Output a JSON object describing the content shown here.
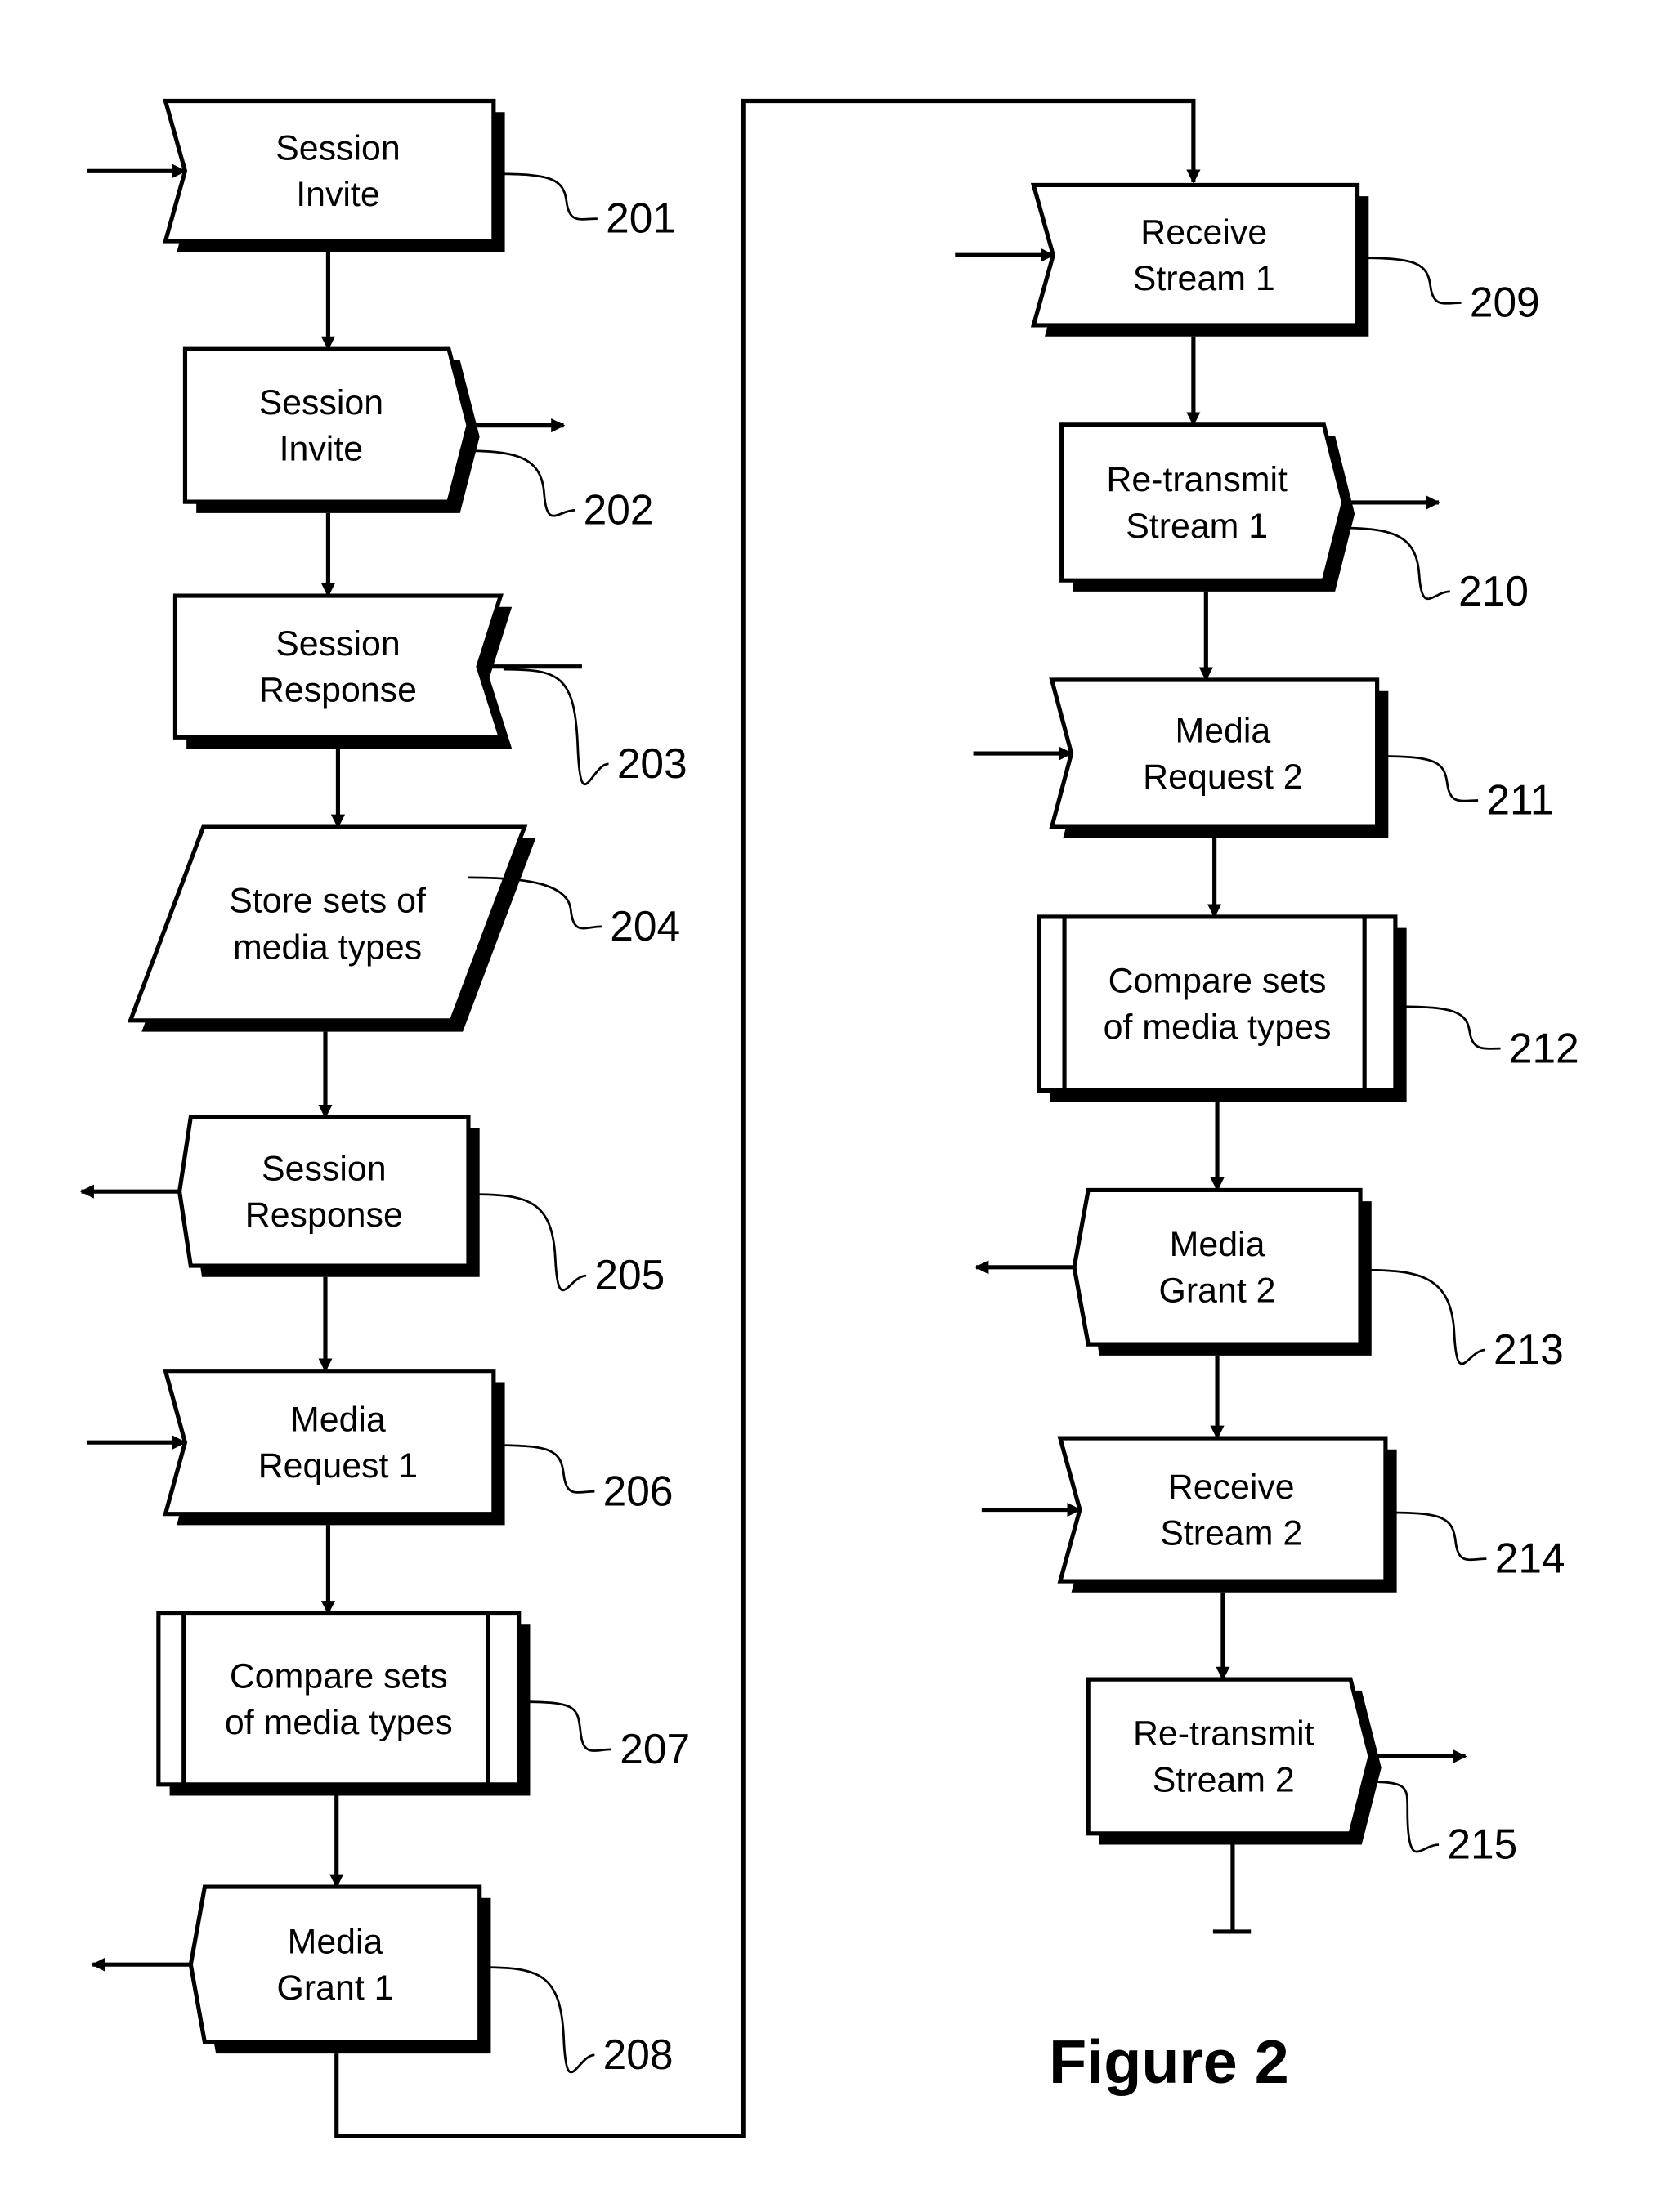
{
  "figure": {
    "caption": "Figure 2"
  },
  "steps": [
    {
      "ref": "201",
      "lines": [
        "Session",
        "Invite"
      ],
      "kind": "receive-left"
    },
    {
      "ref": "202",
      "lines": [
        "Session",
        "Invite"
      ],
      "kind": "send-right"
    },
    {
      "ref": "203",
      "lines": [
        "Session",
        "Response"
      ],
      "kind": "receive-right"
    },
    {
      "ref": "204",
      "lines": [
        "Store sets of",
        "media types"
      ],
      "kind": "data"
    },
    {
      "ref": "205",
      "lines": [
        "Session",
        "Response"
      ],
      "kind": "send-left"
    },
    {
      "ref": "206",
      "lines": [
        "Media",
        "Request 1"
      ],
      "kind": "receive-left"
    },
    {
      "ref": "207",
      "lines": [
        "Compare sets",
        "of media types"
      ],
      "kind": "predefined-process"
    },
    {
      "ref": "208",
      "lines": [
        "Media",
        "Grant 1"
      ],
      "kind": "send-left"
    },
    {
      "ref": "209",
      "lines": [
        "Receive",
        "Stream 1"
      ],
      "kind": "receive-left"
    },
    {
      "ref": "210",
      "lines": [
        "Re-transmit",
        "Stream 1"
      ],
      "kind": "send-right"
    },
    {
      "ref": "211",
      "lines": [
        "Media",
        "Request 2"
      ],
      "kind": "receive-left"
    },
    {
      "ref": "212",
      "lines": [
        "Compare sets",
        "of media types"
      ],
      "kind": "predefined-process"
    },
    {
      "ref": "213",
      "lines": [
        "Media",
        "Grant 2"
      ],
      "kind": "send-left"
    },
    {
      "ref": "214",
      "lines": [
        "Receive",
        "Stream 2"
      ],
      "kind": "receive-left"
    },
    {
      "ref": "215",
      "lines": [
        "Re-transmit",
        "Stream 2"
      ],
      "kind": "send-right"
    }
  ]
}
